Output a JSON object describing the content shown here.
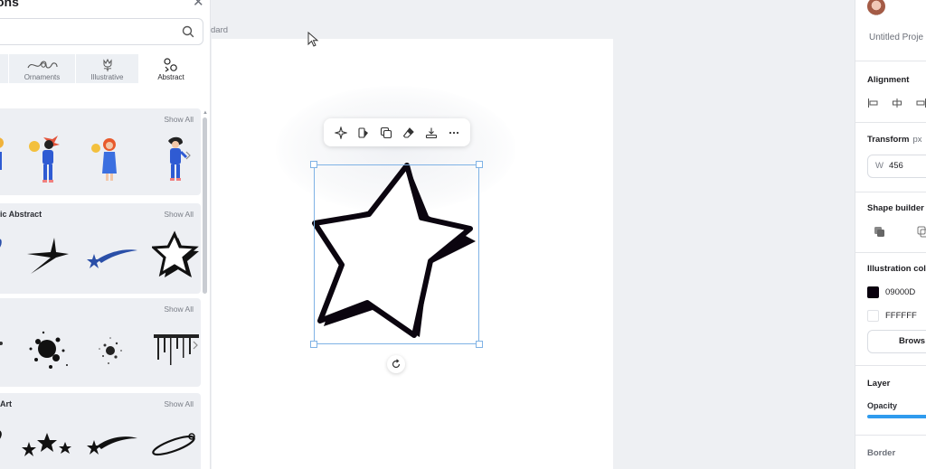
{
  "left_panel": {
    "title": "ons",
    "search": {
      "placeholder": ""
    },
    "categories": [
      {
        "label": "",
        "icon": "category-icon"
      },
      {
        "label": "Ornaments",
        "icon": "ornament-swirl-icon"
      },
      {
        "label": "Illustrative",
        "icon": "tulip-icon"
      },
      {
        "label": "Abstract",
        "icon": "abstract-shapes-icon",
        "active": true
      }
    ],
    "sections": [
      {
        "title": "",
        "show_all": "Show All",
        "thumbs": [
          "character-illustration",
          "character-illustration",
          "character-illustration",
          "character-illustration"
        ]
      },
      {
        "title": "ic Abstract",
        "show_all": "Show All",
        "thumbs": [
          "swoosh",
          "sparkle",
          "shooting-star",
          "star-3d"
        ]
      },
      {
        "title": "",
        "show_all": "Show All",
        "thumbs": [
          "splatter",
          "ink-splat",
          "spray",
          "drips"
        ]
      },
      {
        "title": "Art",
        "show_all": "Show All",
        "thumbs": [
          "loop",
          "stars-cluster",
          "shooting-star",
          "planet-ring"
        ]
      }
    ]
  },
  "canvas": {
    "label": "dard",
    "toolbar": [
      "ai-sparkle-icon",
      "replace-shape-icon",
      "duplicate-icon",
      "eraser-icon",
      "download-icon",
      "more-icon"
    ],
    "selected_element": "3d-star"
  },
  "right_panel": {
    "project_name": "Untitled Proje",
    "alignment": {
      "label": "Alignment"
    },
    "transform": {
      "label": "Transform",
      "unit": "px",
      "width_label": "W",
      "width_value": "456"
    },
    "shape_builder": {
      "label": "Shape builder"
    },
    "illustration_colors": {
      "label": "Illustration col",
      "colors": [
        {
          "hex": "09000D",
          "swatch": "#09000D"
        },
        {
          "hex": "FFFFFF",
          "swatch": "#FFFFFF"
        }
      ],
      "browse_label": "Brows"
    },
    "layer": {
      "label": "Layer",
      "opacity_label": "Opacity",
      "opacity_value": 100
    },
    "border": {
      "label": "Border"
    }
  },
  "colors": {
    "accent": "#2f9bee",
    "selection": "#7fb2e5",
    "star_fill": "#ffffff",
    "star_stroke": "#09000D"
  }
}
